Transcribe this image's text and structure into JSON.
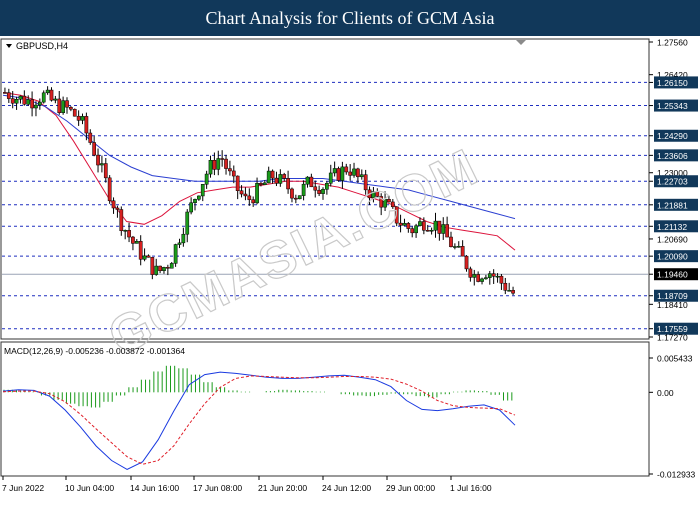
{
  "header": {
    "title": "Chart Analysis for Clients of GCM Asia"
  },
  "chart_data": [
    {
      "type": "candlestick",
      "symbol_label": "GBPUSD,H4",
      "y_axis_labels": [
        "1.27560",
        "1.26420",
        "1.26150",
        "1.25343",
        "1.24290",
        "1.23606",
        "1.23000",
        "1.22703",
        "1.21881",
        "1.21132",
        "1.20690",
        "1.20090",
        "1.19460",
        "1.18709",
        "1.18410",
        "1.17559",
        "1.17270"
      ],
      "ylim": [
        1.1727,
        1.2756
      ],
      "price_levels": [
        {
          "value": 1.2615,
          "label": "1.26150"
        },
        {
          "value": 1.25343,
          "label": "1.25343"
        },
        {
          "value": 1.2429,
          "label": "1.24290"
        },
        {
          "value": 1.23606,
          "label": "1.23606"
        },
        {
          "value": 1.22703,
          "label": "1.22703"
        },
        {
          "value": 1.21881,
          "label": "1.21881"
        },
        {
          "value": 1.21132,
          "label": "1.21132"
        },
        {
          "value": 1.2009,
          "label": "1.20090"
        },
        {
          "value": 1.18709,
          "label": "1.18709"
        },
        {
          "value": 1.17559,
          "label": "1.17559"
        }
      ],
      "current_price": {
        "value": 1.1946,
        "label": "1.19460"
      },
      "close_path": [
        1.258,
        1.256,
        1.255,
        1.257,
        1.254,
        1.252,
        1.248,
        1.238,
        1.226,
        1.214,
        1.206,
        1.2,
        1.195,
        1.199,
        1.211,
        1.222,
        1.231,
        1.236,
        1.226,
        1.22,
        1.224,
        1.229,
        1.226,
        1.222,
        1.227,
        1.225,
        1.229,
        1.232,
        1.227,
        1.222,
        1.219,
        1.213,
        1.21,
        1.213,
        1.212,
        1.206,
        1.2,
        1.194,
        1.196,
        1.192,
        1.188
      ],
      "overlay_series": [
        {
          "color": "#dc143c",
          "values": [
            1.258,
            1.257,
            1.255,
            1.25,
            1.241,
            1.231,
            1.221,
            1.213,
            1.212,
            1.215,
            1.22,
            1.223,
            1.224,
            1.225,
            1.225,
            1.226,
            1.227,
            1.227,
            1.226,
            1.225,
            1.223,
            1.221,
            1.219,
            1.216,
            1.213,
            1.211,
            1.21,
            1.209,
            1.208,
            1.203
          ]
        },
        {
          "color": "#2b3fd1",
          "values": [
            1.257,
            1.256,
            1.253,
            1.248,
            1.242,
            1.236,
            1.232,
            1.229,
            1.228,
            1.227,
            1.227,
            1.227,
            1.227,
            1.228,
            1.228,
            1.228,
            1.227,
            1.226,
            1.225,
            1.224,
            1.222,
            1.22,
            1.218,
            1.216,
            1.214
          ]
        }
      ]
    },
    {
      "type": "macd",
      "title": "MACD(12,26,9) -0.005236 -0.003872 -0.001364",
      "y_axis_labels": [
        "0.005433",
        "0.00",
        "-0.012933"
      ],
      "ylim": [
        -0.012933,
        0.005433
      ],
      "histogram": [
        0.0004,
        0.0003,
        0.0001,
        -0.0005,
        -0.0012,
        -0.0018,
        -0.0022,
        -0.0024,
        -0.0015,
        -0.0005,
        0.0008,
        0.002,
        0.0033,
        0.0042,
        0.0038,
        0.0028,
        0.0016,
        0.0008,
        0.0003,
        0.0001,
        0.0,
        0.0002,
        0.0004,
        0.0003,
        0.0002,
        0.0001,
        0.0,
        -0.0003,
        -0.0005,
        -0.0006,
        -0.0004,
        -0.0002,
        -0.0003,
        -0.0006,
        -0.0008,
        -0.0003,
        0.0001,
        0.0003,
        0.0002,
        -0.0004,
        -0.0013
      ],
      "series": [
        {
          "color": "#1a3ae0",
          "values": [
            0.0002,
            0.0004,
            0.0003,
            -0.0006,
            -0.0028,
            -0.0055,
            -0.0085,
            -0.0108,
            -0.0122,
            -0.011,
            -0.0075,
            -0.003,
            0.0012,
            0.0028,
            0.0032,
            0.003,
            0.0027,
            0.0024,
            0.0022,
            0.0022,
            0.0024,
            0.0026,
            0.0027,
            0.0024,
            0.002,
            0.0009,
            -0.0013,
            -0.0027,
            -0.0029,
            -0.0026,
            -0.0022,
            -0.002,
            -0.0028,
            -0.0052
          ]
        },
        {
          "color": "#e0202a",
          "values": [
            0.0001,
            0.0002,
            0.0002,
            -0.0002,
            -0.0015,
            -0.0035,
            -0.0058,
            -0.008,
            -0.0102,
            -0.0114,
            -0.0108,
            -0.0085,
            -0.005,
            -0.0018,
            0.0008,
            0.0022,
            0.0026,
            0.0025,
            0.0024,
            0.0023,
            0.0023,
            0.0024,
            0.0025,
            0.0025,
            0.0024,
            0.0021,
            0.0013,
            0.0002,
            -0.0013,
            -0.0021,
            -0.0024,
            -0.0025,
            -0.0026,
            -0.0036
          ]
        }
      ]
    }
  ],
  "time_axis_labels": [
    "7 Jun 2022",
    "10 Jun 04:00",
    "14 Jun 16:00",
    "17 Jun 08:00",
    "21 Jun 20:00",
    "24 Jun 12:00",
    "29 Jun 00:00",
    "1 Jul 16:00"
  ],
  "watermark": "GCMASIA.COM",
  "colors": {
    "banner": "#11385a",
    "bull": "#1a9a1a",
    "bear": "#d62020",
    "level_line": "#1f2fbf",
    "label_box": "#11385a"
  }
}
